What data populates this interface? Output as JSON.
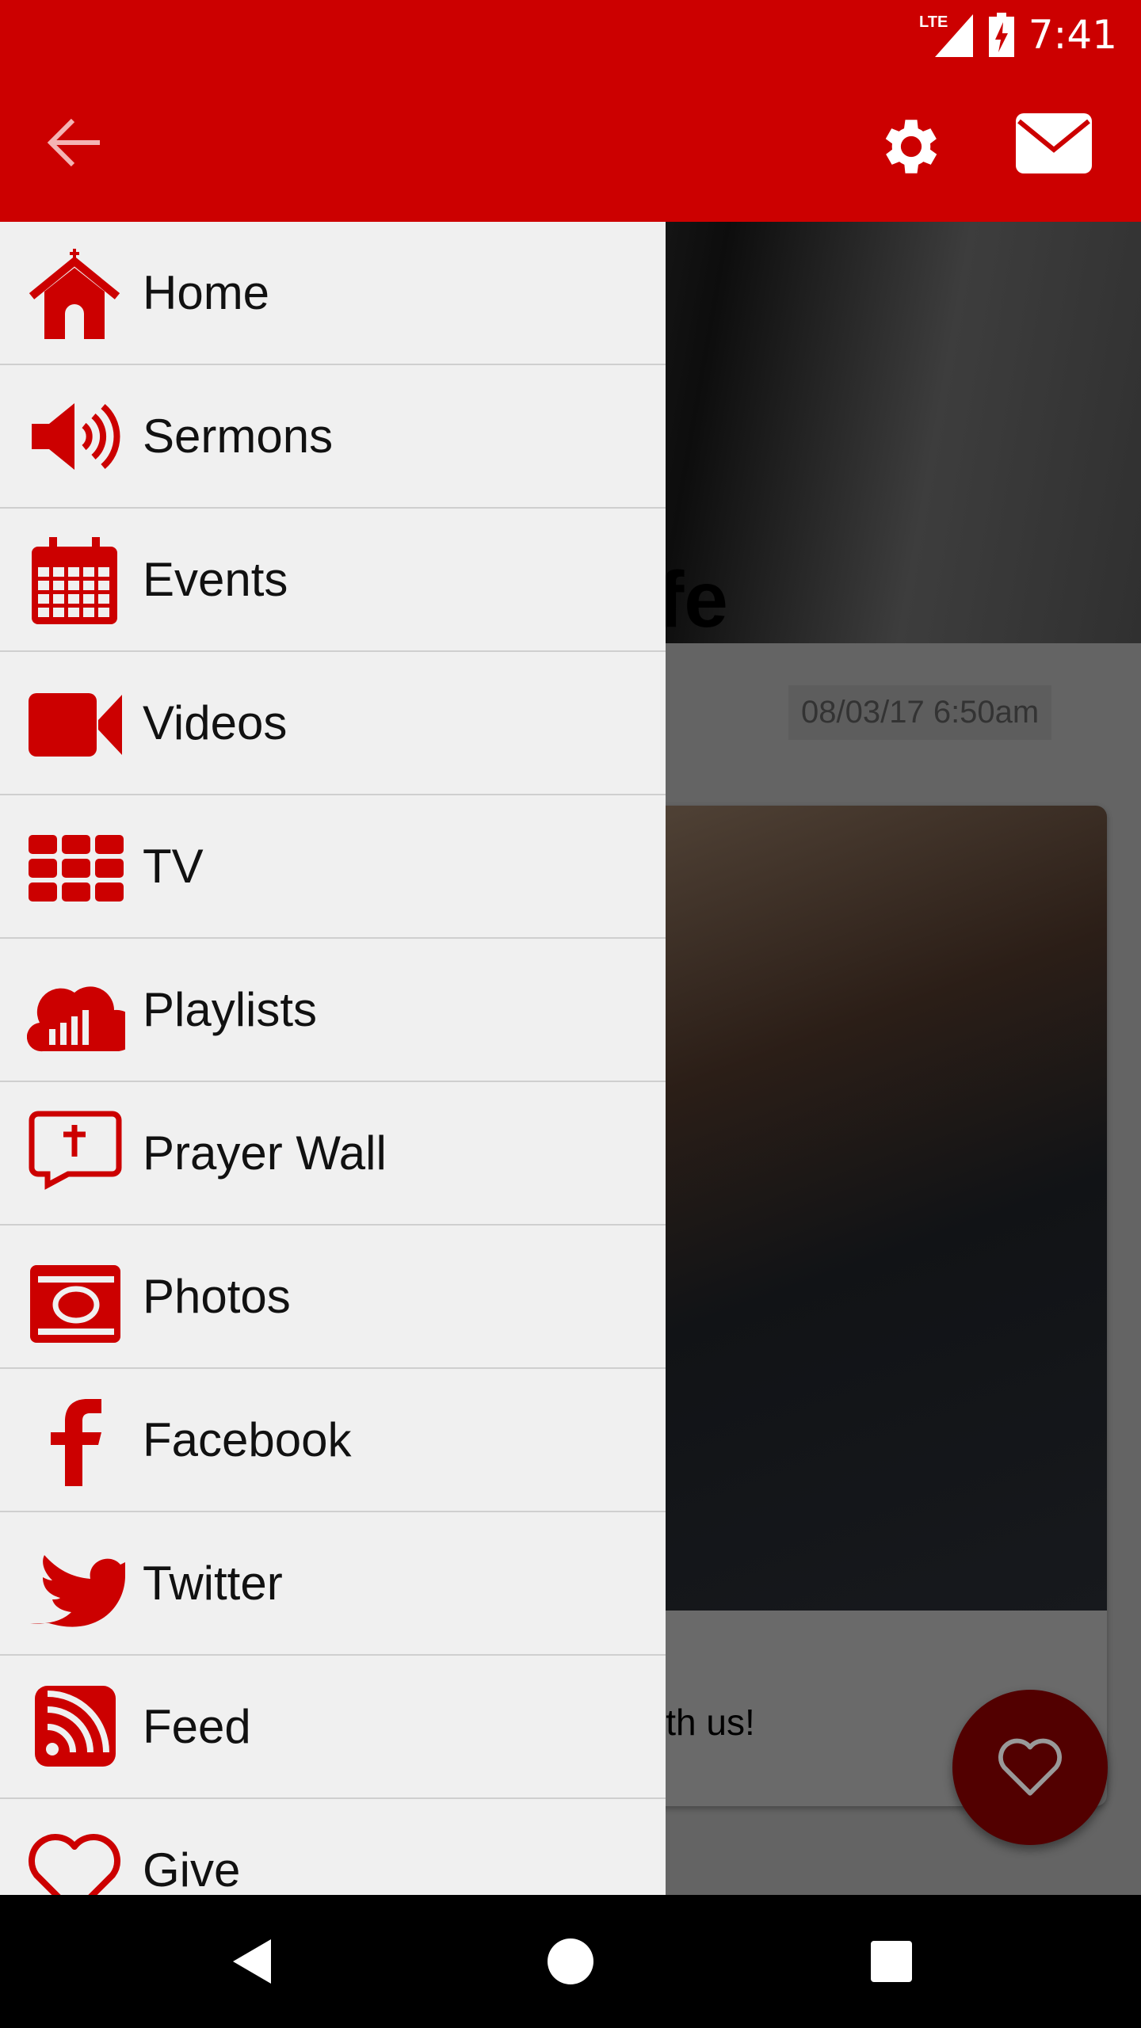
{
  "status_bar": {
    "network": "LTE",
    "time": "7:41",
    "icons": [
      "lte-signal-icon",
      "battery-charging-icon"
    ]
  },
  "app_bar": {
    "back_icon": "arrow-left-icon",
    "actions": [
      "gear-icon",
      "envelope-icon"
    ]
  },
  "colors": {
    "brand": "#cc0000",
    "drawer_bg": "#f0f0f0"
  },
  "content": {
    "hero_text": "fe",
    "timestamp": "08/03/17 6:50am",
    "card_text": "ith us!"
  },
  "fab": {
    "icon": "heart-outline-icon"
  },
  "drawer": {
    "items": [
      {
        "label": "Home",
        "icon": "church-icon"
      },
      {
        "label": "Sermons",
        "icon": "speaker-icon"
      },
      {
        "label": "Events",
        "icon": "calendar-icon"
      },
      {
        "label": "Videos",
        "icon": "video-camera-icon"
      },
      {
        "label": "TV",
        "icon": "grid-icon"
      },
      {
        "label": "Playlists",
        "icon": "cloud-bars-icon"
      },
      {
        "label": "Prayer Wall",
        "icon": "speech-cross-icon"
      },
      {
        "label": "Photos",
        "icon": "camera-icon"
      },
      {
        "label": "Facebook",
        "icon": "facebook-icon"
      },
      {
        "label": "Twitter",
        "icon": "twitter-icon"
      },
      {
        "label": "Feed",
        "icon": "rss-icon"
      },
      {
        "label": "Give",
        "icon": "heart-icon"
      }
    ]
  },
  "nav_bar": {
    "buttons": [
      "back-triangle-icon",
      "home-circle-icon",
      "recents-square-icon"
    ]
  }
}
